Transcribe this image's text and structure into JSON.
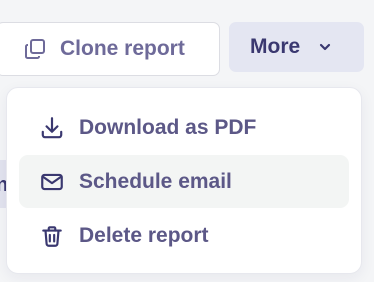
{
  "toolbar": {
    "clone_label": "Clone report",
    "more_label": "More"
  },
  "menu": {
    "items": [
      {
        "label": "Download as PDF",
        "icon": "download-icon",
        "highlighted": false
      },
      {
        "label": "Schedule email",
        "icon": "mail-icon",
        "highlighted": true
      },
      {
        "label": "Delete report",
        "icon": "trash-icon",
        "highlighted": false
      }
    ]
  },
  "background": {
    "partial_text": "n"
  },
  "colors": {
    "primary_text": "#3a3870",
    "muted_text": "#6e6a99",
    "menu_text": "#5c5887",
    "more_button_bg": "#e4e6f2",
    "highlight_bg": "#f3f5f4"
  }
}
